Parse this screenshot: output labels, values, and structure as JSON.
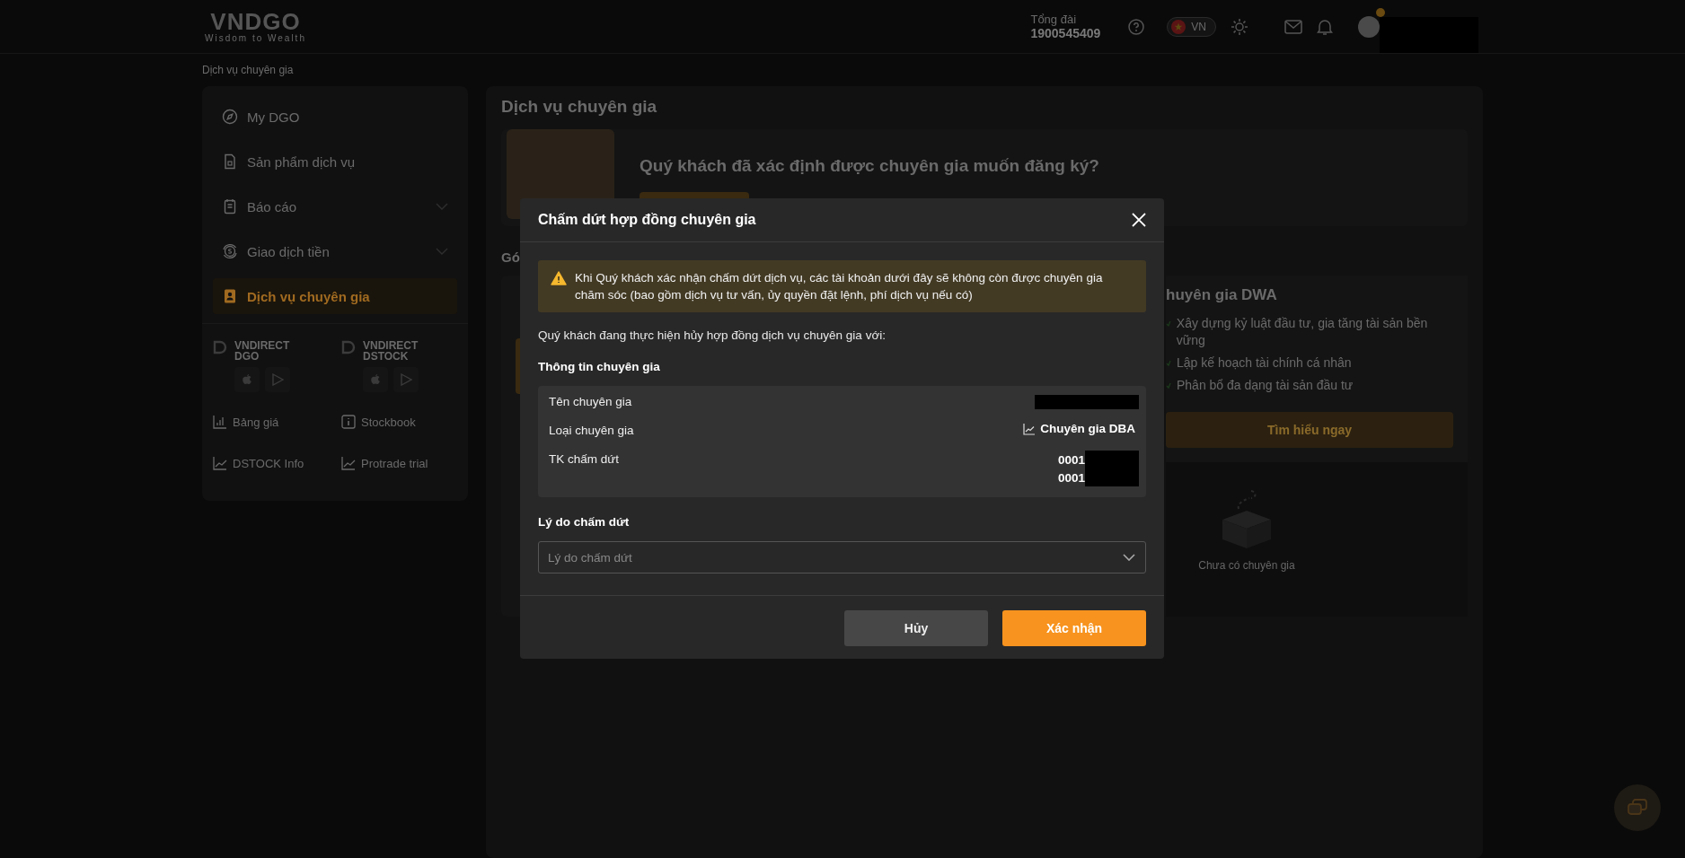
{
  "header": {
    "logo": "VNDGO",
    "tagline": "Wisdom to Wealth",
    "hotline_label": "Tổng đài",
    "hotline": "1900545409",
    "language": "VN"
  },
  "breadcrumb": "Dịch vụ chuyên gia",
  "sidebar": {
    "items": [
      {
        "label": "My DGO",
        "kind": "link",
        "selected": false
      },
      {
        "label": "Sản phẩm dịch vụ",
        "kind": "link",
        "selected": false
      },
      {
        "label": "Báo cáo",
        "kind": "group",
        "selected": false
      },
      {
        "label": "Giao dịch tiền",
        "kind": "group",
        "selected": false
      },
      {
        "label": "Dịch vụ chuyên gia",
        "kind": "link",
        "selected": true
      }
    ],
    "apps": [
      {
        "name": "VNDIRECT DGO"
      },
      {
        "name": "VNDIRECT DSTOCK"
      }
    ],
    "links": [
      {
        "label": "Bảng giá"
      },
      {
        "label": "Stockbook"
      },
      {
        "label": "DSTOCK Info"
      },
      {
        "label": "Protrade trial"
      }
    ]
  },
  "page": {
    "title": "Dịch vụ chuyên gia",
    "banner_text": "Quý khách đã xác định được chuyên gia muốn đăng ký?",
    "section_heading": "Gó",
    "card": {
      "title": "huyên gia DWA",
      "features": [
        "Xây dựng kỷ luật đầu tư, gia tăng tài sản bền vững",
        "Lập kế hoạch tài chính cá nhân",
        "Phân bổ đa dạng tài sản đầu tư"
      ],
      "button": "Tìm hiểu ngay"
    },
    "empty_text": "Chưa có chuyên gia"
  },
  "dialog": {
    "title": "Chấm dứt hợp đồng chuyên gia",
    "warning": "Khi Quý khách xác nhận chấm dứt dịch vụ, các tài khoản dưới đây sẽ không còn được chuyên gia chăm sóc (bao gồm dịch vụ tư vấn, ủy quyền đặt lệnh, phí dịch vụ nếu có)",
    "intro": "Quý khách đang thực hiện hủy hợp đồng dịch vụ chuyên gia với:",
    "info_heading": "Thông tin chuyên gia",
    "rows": [
      {
        "label": "Tên chuyên gia",
        "kind": "redacted"
      },
      {
        "label": "Loại chuyên gia",
        "kind": "type",
        "value": "Chuyên gia DBA"
      },
      {
        "label": "TK chấm dứt",
        "kind": "accounts",
        "values": [
          "0001",
          "0001"
        ]
      }
    ],
    "reason_label": "Lý do chấm dứt",
    "reason": {
      "placeholder": "Lý do chấm dứt"
    },
    "buttons": [
      {
        "label": "Hủy",
        "kind": "secondary"
      },
      {
        "label": "Xác nhận",
        "kind": "primary"
      }
    ]
  }
}
